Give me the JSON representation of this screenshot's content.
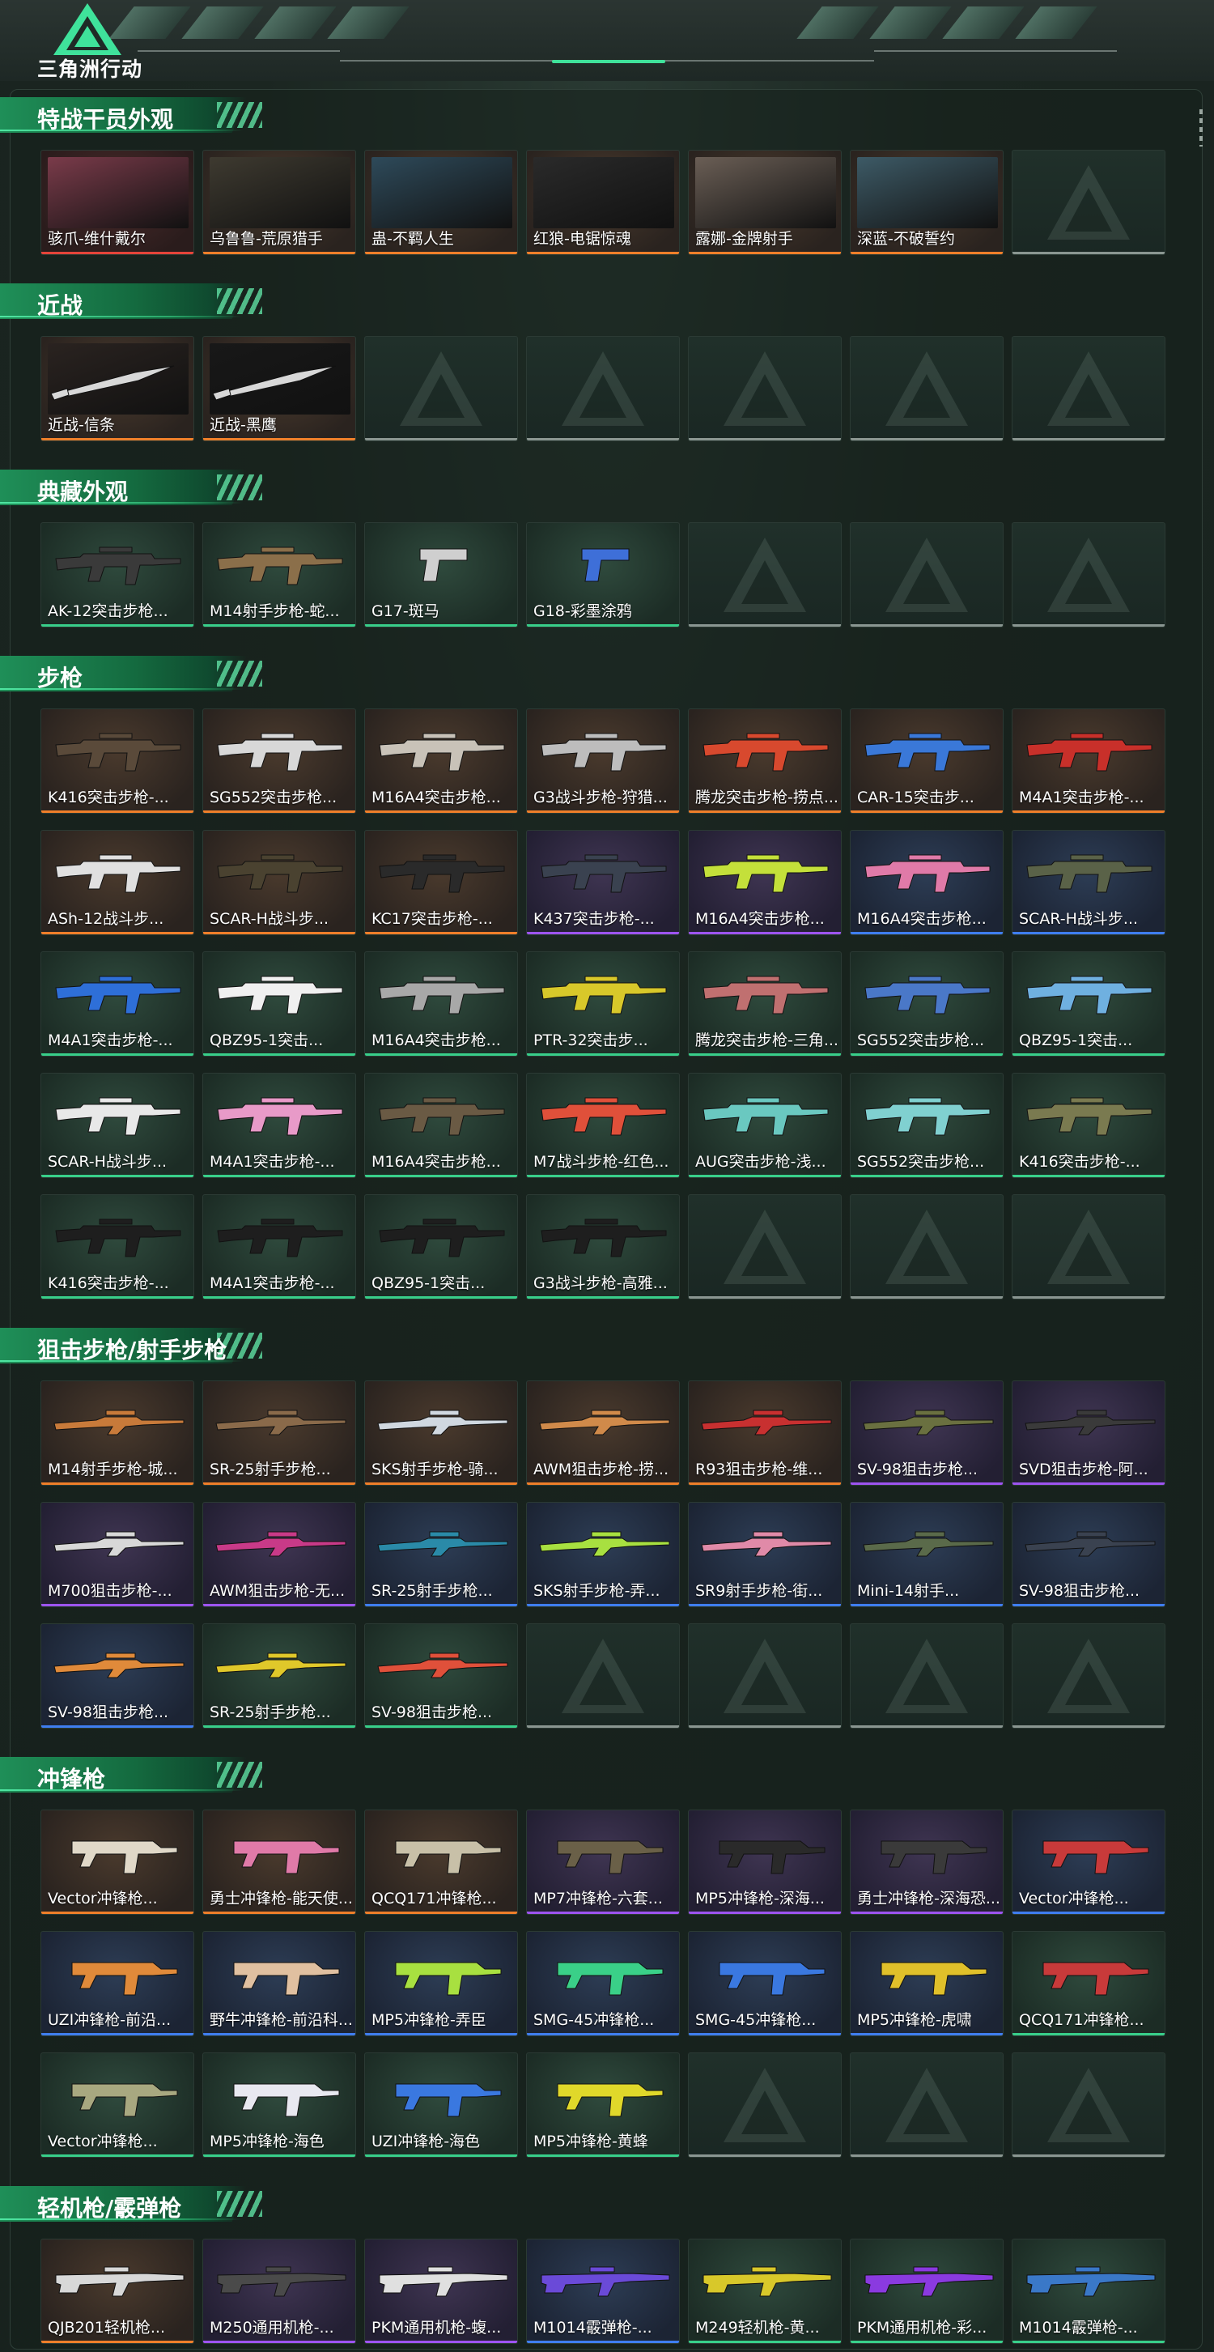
{
  "app": {
    "title": "三角洲行动"
  },
  "colors": {
    "accent": "#3fe29b",
    "section_green": "#1f8f58",
    "quality": {
      "orange": "#ef7f2a",
      "purple": "#9d54f0",
      "blue": "#3f7ef0",
      "green": "#38cf8a",
      "red": "#e5443a"
    }
  },
  "sections": [
    {
      "title": "特战干员外观",
      "items": [
        {
          "label": "骇爪-维什戴尔",
          "quality": "red",
          "icon": "operator-portrait-icon",
          "photo": "#7a3b4a"
        },
        {
          "label": "乌鲁鲁-荒原猎手",
          "quality": "orange",
          "icon": "operator-portrait-icon",
          "photo": "#3e3a30"
        },
        {
          "label": "蛊-不羁人生",
          "quality": "orange",
          "icon": "operator-portrait-icon",
          "photo": "#2e4a5a"
        },
        {
          "label": "红狼-电锯惊魂",
          "quality": "orange",
          "icon": "operator-portrait-icon",
          "photo": "#2a2a2a"
        },
        {
          "label": "露娜-金牌射手",
          "quality": "orange",
          "icon": "operator-portrait-icon",
          "photo": "#6a5e55"
        },
        {
          "label": "深蓝-不破誓约",
          "quality": "orange",
          "icon": "operator-portrait-icon",
          "photo": "#3d5a66"
        },
        {
          "label": "",
          "quality": "empty",
          "icon": "empty-slot-icon"
        }
      ]
    },
    {
      "title": "近战",
      "items": [
        {
          "label": "近战-信条",
          "quality": "orange",
          "icon": "knife-icon",
          "photo": "#2a2320"
        },
        {
          "label": "近战-黑鹰",
          "quality": "orange",
          "icon": "knife-icon",
          "photo": "#181818"
        },
        {
          "label": "",
          "quality": "empty",
          "icon": "empty-slot-icon"
        },
        {
          "label": "",
          "quality": "empty",
          "icon": "empty-slot-icon"
        },
        {
          "label": "",
          "quality": "empty",
          "icon": "empty-slot-icon"
        },
        {
          "label": "",
          "quality": "empty",
          "icon": "empty-slot-icon"
        },
        {
          "label": "",
          "quality": "empty",
          "icon": "empty-slot-icon"
        }
      ]
    },
    {
      "title": "典藏外观",
      "items": [
        {
          "label": "AK-12突击步枪...",
          "quality": "green",
          "icon": "rifle-icon",
          "color": "#3a3a3a"
        },
        {
          "label": "M14射手步枪-蛇...",
          "quality": "green",
          "icon": "rifle-icon",
          "color": "#8b6f4a"
        },
        {
          "label": "G17-斑马",
          "quality": "green",
          "icon": "pistol-icon",
          "color": "#cfcfcf"
        },
        {
          "label": "G18-彩墨涂鸦",
          "quality": "green",
          "icon": "pistol-icon",
          "color": "#3e6fd8"
        },
        {
          "label": "",
          "quality": "empty",
          "icon": "empty-slot-icon"
        },
        {
          "label": "",
          "quality": "empty",
          "icon": "empty-slot-icon"
        },
        {
          "label": "",
          "quality": "empty",
          "icon": "empty-slot-icon"
        }
      ]
    },
    {
      "title": "步枪",
      "items": [
        {
          "label": "K416突击步枪-...",
          "quality": "orange",
          "icon": "rifle-icon",
          "color": "#5a4a3a"
        },
        {
          "label": "SG552突击步枪...",
          "quality": "orange",
          "icon": "rifle-icon",
          "color": "#d8d8d8"
        },
        {
          "label": "M16A4突击步枪...",
          "quality": "orange",
          "icon": "rifle-icon",
          "color": "#c8c2b8"
        },
        {
          "label": "G3战斗步枪-狩猎...",
          "quality": "orange",
          "icon": "rifle-icon",
          "color": "#bdbdbd"
        },
        {
          "label": "腾龙突击步枪-捞点...",
          "quality": "orange",
          "icon": "rifle-icon",
          "color": "#d8492e"
        },
        {
          "label": "CAR-15突击步...",
          "quality": "orange",
          "icon": "rifle-icon",
          "color": "#3a78d8"
        },
        {
          "label": "M4A1突击步枪-...",
          "quality": "orange",
          "icon": "rifle-icon",
          "color": "#c8302a"
        },
        {
          "label": "ASh-12战斗步...",
          "quality": "orange",
          "icon": "rifle-icon",
          "color": "#e0e0e0"
        },
        {
          "label": "SCAR-H战斗步...",
          "quality": "orange",
          "icon": "rifle-icon",
          "color": "#4a4230"
        },
        {
          "label": "KC17突击步枪-...",
          "quality": "orange",
          "icon": "rifle-icon",
          "color": "#2a2a2a"
        },
        {
          "label": "K437突击步枪-...",
          "quality": "purple",
          "icon": "rifle-icon",
          "color": "#3a4250"
        },
        {
          "label": "M16A4突击步枪...",
          "quality": "purple",
          "icon": "rifle-icon",
          "color": "#c4e03a"
        },
        {
          "label": "M16A4突击步枪...",
          "quality": "blue",
          "icon": "rifle-icon",
          "color": "#e07aa8"
        },
        {
          "label": "SCAR-H战斗步...",
          "quality": "blue",
          "icon": "rifle-icon",
          "color": "#5a6248"
        },
        {
          "label": "M4A1突击步枪-...",
          "quality": "green",
          "icon": "rifle-icon",
          "color": "#2e6fd8"
        },
        {
          "label": "QBZ95-1突击...",
          "quality": "green",
          "icon": "rifle-icon",
          "color": "#f0f0f0"
        },
        {
          "label": "M16A4突击步枪...",
          "quality": "green",
          "icon": "rifle-icon",
          "color": "#a8a8a8"
        },
        {
          "label": "PTR-32突击步...",
          "quality": "green",
          "icon": "rifle-icon",
          "color": "#d8c82a"
        },
        {
          "label": "腾龙突击步枪-三角...",
          "quality": "green",
          "icon": "rifle-icon",
          "color": "#c07070"
        },
        {
          "label": "SG552突击步枪...",
          "quality": "green",
          "icon": "rifle-icon",
          "color": "#4a78c8"
        },
        {
          "label": "QBZ95-1突击...",
          "quality": "green",
          "icon": "rifle-icon",
          "color": "#6fb0e0"
        },
        {
          "label": "SCAR-H战斗步...",
          "quality": "green",
          "icon": "rifle-icon",
          "color": "#e8e8e8"
        },
        {
          "label": "M4A1突击步枪-...",
          "quality": "green",
          "icon": "rifle-icon",
          "color": "#e89ac8"
        },
        {
          "label": "M16A4突击步枪...",
          "quality": "green",
          "icon": "rifle-icon",
          "color": "#6a5a44"
        },
        {
          "label": "M7战斗步枪-红色...",
          "quality": "green",
          "icon": "rifle-icon",
          "color": "#e0503a"
        },
        {
          "label": "AUG突击步枪-浅...",
          "quality": "green",
          "icon": "rifle-icon",
          "color": "#6ac8c0"
        },
        {
          "label": "SG552突击步枪...",
          "quality": "green",
          "icon": "rifle-icon",
          "color": "#80d0d0"
        },
        {
          "label": "K416突击步枪-...",
          "quality": "green",
          "icon": "rifle-icon",
          "color": "#7a7a50"
        },
        {
          "label": "K416突击步枪-...",
          "quality": "green",
          "icon": "rifle-icon",
          "color": "#1e1e1e"
        },
        {
          "label": "M4A1突击步枪-...",
          "quality": "green",
          "icon": "rifle-icon",
          "color": "#1e1e1e"
        },
        {
          "label": "QBZ95-1突击...",
          "quality": "green",
          "icon": "rifle-icon",
          "color": "#1e1e1e"
        },
        {
          "label": "G3战斗步枪-高雅...",
          "quality": "green",
          "icon": "rifle-icon",
          "color": "#1e1e1e"
        },
        {
          "label": "",
          "quality": "empty",
          "icon": "empty-slot-icon"
        },
        {
          "label": "",
          "quality": "empty",
          "icon": "empty-slot-icon"
        },
        {
          "label": "",
          "quality": "empty",
          "icon": "empty-slot-icon"
        }
      ]
    },
    {
      "title": "狙击步枪/射手步枪",
      "items": [
        {
          "label": "M14射手步枪-城...",
          "quality": "orange",
          "icon": "sniper-icon",
          "color": "#c87a3a"
        },
        {
          "label": "SR-25射手步枪...",
          "quality": "orange",
          "icon": "sniper-icon",
          "color": "#8a6a4a"
        },
        {
          "label": "SKS射手步枪-骑...",
          "quality": "orange",
          "icon": "sniper-icon",
          "color": "#d0d8e0"
        },
        {
          "label": "AWM狙击步枪-捞...",
          "quality": "orange",
          "icon": "sniper-icon",
          "color": "#d08a4a"
        },
        {
          "label": "R93狙击步枪-维...",
          "quality": "orange",
          "icon": "sniper-icon",
          "color": "#c83030"
        },
        {
          "label": "SV-98狙击步枪...",
          "quality": "purple",
          "icon": "sniper-icon",
          "color": "#6a7040"
        },
        {
          "label": "SVD狙击步枪-阿...",
          "quality": "purple",
          "icon": "sniper-icon",
          "color": "#3a3a3a"
        },
        {
          "label": "M700狙击步枪-...",
          "quality": "purple",
          "icon": "sniper-icon",
          "color": "#d8d8d8"
        },
        {
          "label": "AWM狙击步枪-无...",
          "quality": "purple",
          "icon": "sniper-icon",
          "color": "#c83a88"
        },
        {
          "label": "SR-25射手步枪...",
          "quality": "blue",
          "icon": "sniper-icon",
          "color": "#2a8aa8"
        },
        {
          "label": "SKS射手步枪-弄...",
          "quality": "blue",
          "icon": "sniper-icon",
          "color": "#a8e040"
        },
        {
          "label": "SR9射手步枪-街...",
          "quality": "blue",
          "icon": "sniper-icon",
          "color": "#e08aa8"
        },
        {
          "label": "Mini-14射手...",
          "quality": "blue",
          "icon": "sniper-icon",
          "color": "#5a6a4a"
        },
        {
          "label": "SV-98狙击步枪...",
          "quality": "blue",
          "icon": "sniper-icon",
          "color": "#3a4250"
        },
        {
          "label": "SV-98狙击步枪...",
          "quality": "blue",
          "icon": "sniper-icon",
          "color": "#e08a3a"
        },
        {
          "label": "SR-25射手步枪...",
          "quality": "green",
          "icon": "sniper-icon",
          "color": "#e0c82a"
        },
        {
          "label": "SV-98狙击步枪...",
          "quality": "green",
          "icon": "sniper-icon",
          "color": "#e0503a"
        },
        {
          "label": "",
          "quality": "empty",
          "icon": "empty-slot-icon"
        },
        {
          "label": "",
          "quality": "empty",
          "icon": "empty-slot-icon"
        },
        {
          "label": "",
          "quality": "empty",
          "icon": "empty-slot-icon"
        },
        {
          "label": "",
          "quality": "empty",
          "icon": "empty-slot-icon"
        }
      ]
    },
    {
      "title": "冲锋枪",
      "items": [
        {
          "label": "Vector冲锋枪...",
          "quality": "orange",
          "icon": "smg-icon",
          "color": "#e0d8c8"
        },
        {
          "label": "勇士冲锋枪-能天使...",
          "quality": "orange",
          "icon": "smg-icon",
          "color": "#e07aa8"
        },
        {
          "label": "QCQ171冲锋枪...",
          "quality": "orange",
          "icon": "smg-icon",
          "color": "#c8c0a8"
        },
        {
          "label": "MP7冲锋枪-六套...",
          "quality": "purple",
          "icon": "smg-icon",
          "color": "#6a6048"
        },
        {
          "label": "MP5冲锋枪-深海...",
          "quality": "purple",
          "icon": "smg-icon",
          "color": "#2a2a2a"
        },
        {
          "label": "勇士冲锋枪-深海恐...",
          "quality": "purple",
          "icon": "smg-icon",
          "color": "#3a3a3a"
        },
        {
          "label": "Vector冲锋枪...",
          "quality": "blue",
          "icon": "smg-icon",
          "color": "#c83a3a"
        },
        {
          "label": "UZI冲锋枪-前沿...",
          "quality": "blue",
          "icon": "smg-icon",
          "color": "#e08a3a"
        },
        {
          "label": "野牛冲锋枪-前沿科...",
          "quality": "blue",
          "icon": "smg-icon",
          "color": "#e0c0a0"
        },
        {
          "label": "MP5冲锋枪-弄臣",
          "quality": "blue",
          "icon": "smg-icon",
          "color": "#a8e040"
        },
        {
          "label": "SMG-45冲锋枪...",
          "quality": "blue",
          "icon": "smg-icon",
          "color": "#3ad088"
        },
        {
          "label": "SMG-45冲锋枪...",
          "quality": "blue",
          "icon": "smg-icon",
          "color": "#3a78e0"
        },
        {
          "label": "MP5冲锋枪-虎啸",
          "quality": "blue",
          "icon": "smg-icon",
          "color": "#e0c02a"
        },
        {
          "label": "QCQ171冲锋枪...",
          "quality": "green",
          "icon": "smg-icon",
          "color": "#c83a3a"
        },
        {
          "label": "Vector冲锋枪...",
          "quality": "green",
          "icon": "smg-icon",
          "color": "#a8a880"
        },
        {
          "label": "MP5冲锋枪-海色",
          "quality": "green",
          "icon": "smg-icon",
          "color": "#e8e8f0"
        },
        {
          "label": "UZI冲锋枪-海色",
          "quality": "green",
          "icon": "smg-icon",
          "color": "#3a78e0"
        },
        {
          "label": "MP5冲锋枪-黄蜂",
          "quality": "green",
          "icon": "smg-icon",
          "color": "#e0d82a"
        },
        {
          "label": "",
          "quality": "empty",
          "icon": "empty-slot-icon"
        },
        {
          "label": "",
          "quality": "empty",
          "icon": "empty-slot-icon"
        },
        {
          "label": "",
          "quality": "empty",
          "icon": "empty-slot-icon"
        }
      ]
    },
    {
      "title": "轻机枪/霰弹枪",
      "items": [
        {
          "label": "QJB201轻机枪...",
          "quality": "orange",
          "icon": "lmg-icon",
          "color": "#d8d8d8"
        },
        {
          "label": "M250通用机枪-...",
          "quality": "purple",
          "icon": "lmg-icon",
          "color": "#4a4a4a"
        },
        {
          "label": "PKM通用机枪-蝮...",
          "quality": "purple",
          "icon": "lmg-icon",
          "color": "#e0e0e0"
        },
        {
          "label": "M1014霰弹枪-...",
          "quality": "blue",
          "icon": "shotgun-icon",
          "color": "#6a4ad8"
        },
        {
          "label": "M249轻机枪-黄...",
          "quality": "green",
          "icon": "lmg-icon",
          "color": "#d8c82a"
        },
        {
          "label": "PKM通用机枪-彩...",
          "quality": "green",
          "icon": "lmg-icon",
          "color": "#8a3ae0"
        },
        {
          "label": "M1014霰弹枪-...",
          "quality": "green",
          "icon": "shotgun-icon",
          "color": "#3a78c8"
        }
      ]
    }
  ]
}
